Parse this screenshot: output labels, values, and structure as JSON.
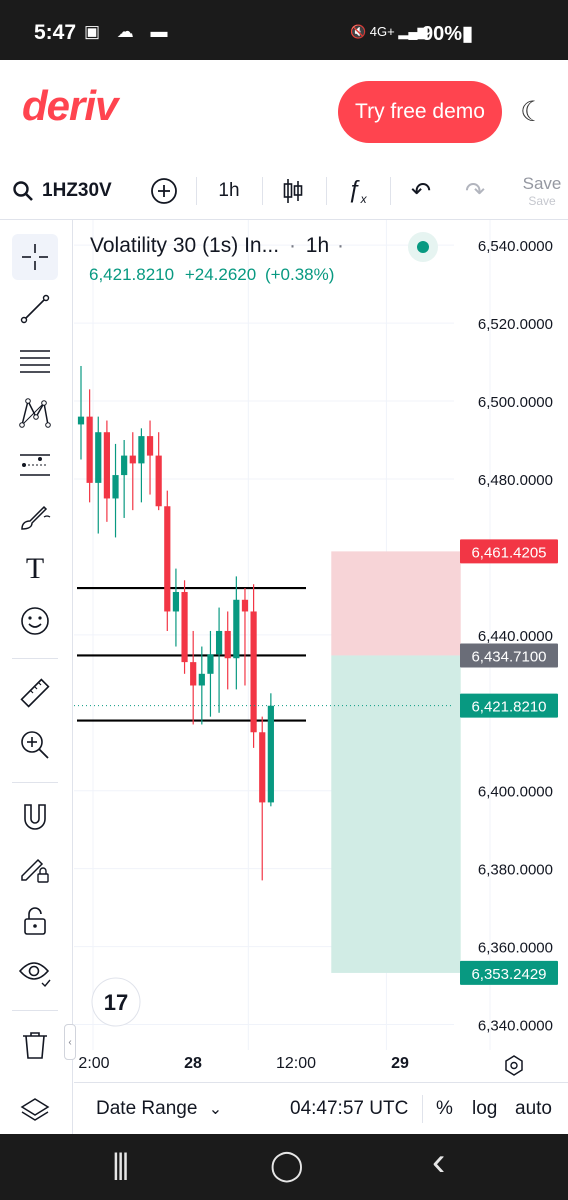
{
  "status_bar": {
    "time": "5:47",
    "left_icons": "▣ ☁ ▬",
    "right_icons": "🔇 4G+ ▂▄▆",
    "battery": "90%▮"
  },
  "header": {
    "logo": "deriv",
    "demo_button": "Try free demo"
  },
  "toolbar": {
    "symbol": "1HZ30V",
    "interval": "1h",
    "save_label": "Save",
    "save_sub": "Save"
  },
  "legend": {
    "title": "Volatility 30 (1s) In...",
    "interval": "1h",
    "dot": "·",
    "price": "6,421.8210",
    "change": "+24.2620",
    "change_pct": "(+0.38%)"
  },
  "chart_data": {
    "type": "candlestick",
    "y_ticks": [
      "6,540.0000",
      "6,520.0000",
      "6,500.0000",
      "6,480.0000",
      "6,440.0000",
      "6,400.0000",
      "6,380.0000",
      "6,360.0000",
      "6,340.0000"
    ],
    "y_tick_values": [
      6540,
      6520,
      6500,
      6480,
      6440,
      6400,
      6380,
      6360,
      6340
    ],
    "x_ticks": [
      "2:00",
      "28",
      "12:00",
      "29"
    ],
    "x_tick_offsets_h": [
      0,
      22,
      34,
      46
    ],
    "ylim": [
      6335,
      6548
    ],
    "price_labels": [
      {
        "text": "6,461.4205",
        "value": 6461.42,
        "color": "#f23645"
      },
      {
        "text": "6,434.7100",
        "value": 6434.71,
        "color": "#6a6d78"
      },
      {
        "text": "6,421.8210",
        "value": 6421.82,
        "color": "#089981"
      },
      {
        "text": "6,353.2429",
        "value": 6353.24,
        "color": "#089981"
      }
    ],
    "hlines": [
      6452,
      6434.71,
      6418
    ],
    "position": {
      "entry": 6434.71,
      "stop": 6461.42,
      "target": 6353.24,
      "start_h": 29,
      "end_h": 44
    },
    "candles": [
      {
        "o": 6494,
        "h": 6509,
        "l": 6485,
        "c": 6496
      },
      {
        "o": 6496,
        "h": 6503,
        "l": 6474,
        "c": 6479
      },
      {
        "o": 6479,
        "h": 6496,
        "l": 6466,
        "c": 6492
      },
      {
        "o": 6492,
        "h": 6495,
        "l": 6469,
        "c": 6475
      },
      {
        "o": 6475,
        "h": 6489,
        "l": 6465,
        "c": 6481
      },
      {
        "o": 6481,
        "h": 6490,
        "l": 6470,
        "c": 6486
      },
      {
        "o": 6486,
        "h": 6492,
        "l": 6472,
        "c": 6484
      },
      {
        "o": 6484,
        "h": 6493,
        "l": 6474,
        "c": 6491
      },
      {
        "o": 6491,
        "h": 6495,
        "l": 6476,
        "c": 6486
      },
      {
        "o": 6486,
        "h": 6492,
        "l": 6472,
        "c": 6473
      },
      {
        "o": 6473,
        "h": 6477,
        "l": 6441,
        "c": 6446
      },
      {
        "o": 6446,
        "h": 6457,
        "l": 6437,
        "c": 6451
      },
      {
        "o": 6451,
        "h": 6454,
        "l": 6430,
        "c": 6433
      },
      {
        "o": 6433,
        "h": 6441,
        "l": 6417,
        "c": 6427
      },
      {
        "o": 6427,
        "h": 6437,
        "l": 6417,
        "c": 6430
      },
      {
        "o": 6430,
        "h": 6441,
        "l": 6419,
        "c": 6435
      },
      {
        "o": 6435,
        "h": 6447,
        "l": 6420,
        "c": 6441
      },
      {
        "o": 6441,
        "h": 6446,
        "l": 6426,
        "c": 6434
      },
      {
        "o": 6434,
        "h": 6455,
        "l": 6426,
        "c": 6449
      },
      {
        "o": 6449,
        "h": 6452,
        "l": 6427,
        "c": 6446
      },
      {
        "o": 6446,
        "h": 6453,
        "l": 6411,
        "c": 6415
      },
      {
        "o": 6415,
        "h": 6419,
        "l": 6377,
        "c": 6397
      },
      {
        "o": 6397,
        "h": 6425,
        "l": 6396,
        "c": 6421.8
      }
    ]
  },
  "bottom": {
    "date_range": "Date Range",
    "chevron": "⌄",
    "clock": "04:47:57 UTC",
    "percent": "%",
    "log": "log",
    "auto": "auto"
  },
  "nav": {
    "recents": "|||",
    "home": "◯",
    "back": "‹"
  }
}
